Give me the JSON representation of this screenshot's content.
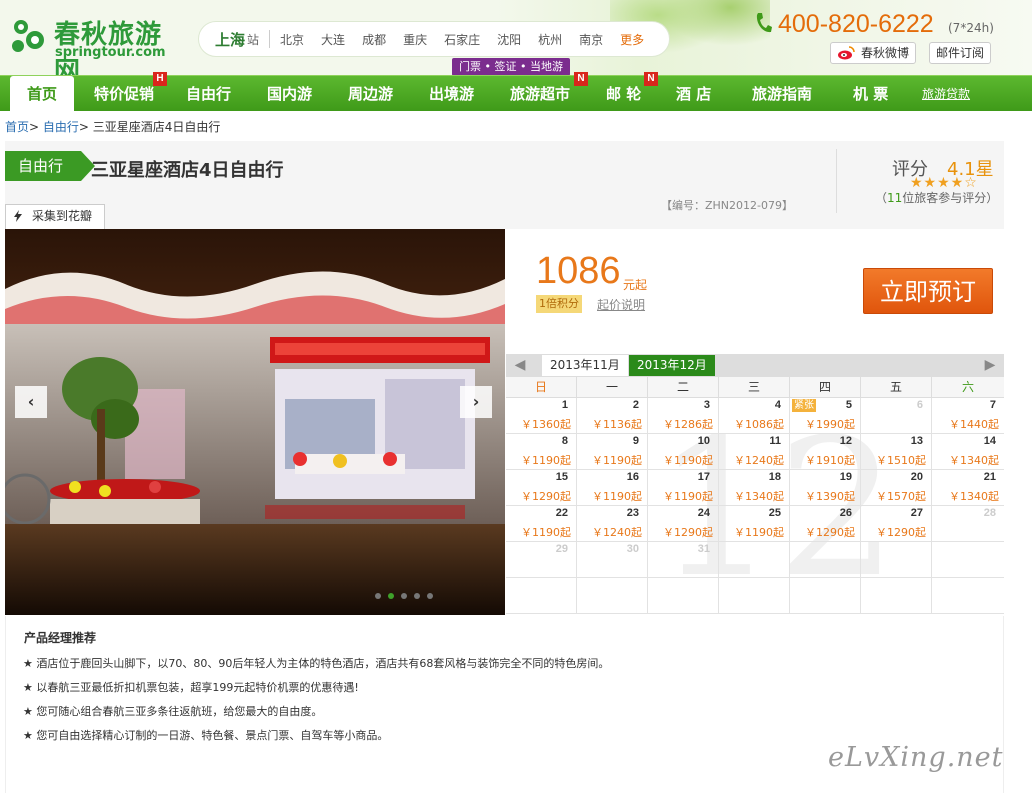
{
  "header": {
    "logo_cn": "春秋旅游网",
    "logo_en": "springtour.com",
    "current_city": "上海",
    "current_city_suffix": "站",
    "cities": [
      "北京",
      "大连",
      "成都",
      "重庆",
      "石家庄",
      "沈阳",
      "杭州",
      "南京"
    ],
    "more": "更多",
    "tag_strip": "门票 • 签证 • 当地游",
    "phone": "400-820-6222",
    "phone_hours": "(7*24h)",
    "weibo": "春秋微博",
    "mail": "邮件订阅"
  },
  "nav": {
    "items": [
      "首页",
      "特价促销",
      "自由行",
      "国内游",
      "周边游",
      "出境游",
      "旅游超市",
      "邮 轮",
      "酒 店",
      "旅游指南",
      "机 票",
      "旅游贷款"
    ],
    "badges": {
      "promo": "H",
      "market": "N",
      "cruise": "N"
    }
  },
  "breadcrumb": {
    "home": "首页",
    "section": "自由行",
    "current": "三亚星座酒店4日自由行"
  },
  "product": {
    "category": "自由行",
    "title": "三亚星座酒店4日自由行",
    "code": "【编号：ZHN2012-079】",
    "score_label": "评分",
    "score_value": "4.1星",
    "score_count_num": "11",
    "score_count_prefix": "（",
    "score_count_suffix": "位旅客参与评分）",
    "stars": "★★★★☆",
    "collect": "采集到花瓣",
    "price": "1086",
    "price_unit": "元起",
    "points": "1倍积分",
    "price_note": "起价说明",
    "book": "立即预订"
  },
  "calendar": {
    "months": [
      "2013年11月",
      "2013年12月"
    ],
    "weekdays": [
      "日",
      "一",
      "二",
      "三",
      "四",
      "五",
      "六"
    ],
    "watermark": "12",
    "weeks": [
      [
        {
          "d": "1",
          "p": "￥1360起"
        },
        {
          "d": "2",
          "p": "￥1136起"
        },
        {
          "d": "3",
          "p": "￥1286起"
        },
        {
          "d": "4",
          "p": "￥1086起"
        },
        {
          "d": "5",
          "p": "￥1990起",
          "tag": "紧张"
        },
        {
          "d": "6",
          "p": "",
          "dim": true
        },
        {
          "d": "7",
          "p": "￥1440起"
        }
      ],
      [
        {
          "d": "8",
          "p": "￥1190起"
        },
        {
          "d": "9",
          "p": "￥1190起"
        },
        {
          "d": "10",
          "p": "￥1190起"
        },
        {
          "d": "11",
          "p": "￥1240起"
        },
        {
          "d": "12",
          "p": "￥1910起"
        },
        {
          "d": "13",
          "p": "￥1510起"
        },
        {
          "d": "14",
          "p": "￥1340起"
        }
      ],
      [
        {
          "d": "15",
          "p": "￥1290起"
        },
        {
          "d": "16",
          "p": "￥1190起"
        },
        {
          "d": "17",
          "p": "￥1190起"
        },
        {
          "d": "18",
          "p": "￥1340起"
        },
        {
          "d": "19",
          "p": "￥1390起"
        },
        {
          "d": "20",
          "p": "￥1570起"
        },
        {
          "d": "21",
          "p": "￥1340起"
        }
      ],
      [
        {
          "d": "22",
          "p": "￥1190起"
        },
        {
          "d": "23",
          "p": "￥1240起"
        },
        {
          "d": "24",
          "p": "￥1290起"
        },
        {
          "d": "25",
          "p": "￥1190起"
        },
        {
          "d": "26",
          "p": "￥1290起"
        },
        {
          "d": "27",
          "p": "￥1290起"
        },
        {
          "d": "28",
          "p": "",
          "dim": true
        }
      ],
      [
        {
          "d": "29",
          "p": "",
          "dim": true
        },
        {
          "d": "30",
          "p": "",
          "dim": true
        },
        {
          "d": "31",
          "p": "",
          "dim": true
        },
        {
          "d": "",
          "p": ""
        },
        {
          "d": "",
          "p": ""
        },
        {
          "d": "",
          "p": ""
        },
        {
          "d": "",
          "p": ""
        }
      ],
      [
        {
          "d": "",
          "p": ""
        },
        {
          "d": "",
          "p": ""
        },
        {
          "d": "",
          "p": ""
        },
        {
          "d": "",
          "p": ""
        },
        {
          "d": "",
          "p": ""
        },
        {
          "d": "",
          "p": ""
        },
        {
          "d": "",
          "p": ""
        }
      ]
    ]
  },
  "recommend": {
    "title": "产品经理推荐",
    "items": [
      "★ 酒店位于鹿回头山脚下，以70、80、90后年轻人为主体的特色酒店，酒店共有68套风格与装饰完全不同的特色房间。",
      "★ 以春航三亚最低折扣机票包装，超享199元起特价机票的优惠待遇!",
      "★ 您可随心组合春航三亚多条往返航班，给您最大的自由度。",
      "★ 您可自由选择精心订制的一日游、特色餐、景点门票、自驾车等小商品。"
    ]
  },
  "slider": {
    "active_dot": 1,
    "dot_count": 5
  },
  "watermark": "eLvXing.net",
  "colors": {
    "brand_green": "#3f9a19",
    "accent_orange": "#e8781a",
    "book_orange": "#e0550c"
  }
}
